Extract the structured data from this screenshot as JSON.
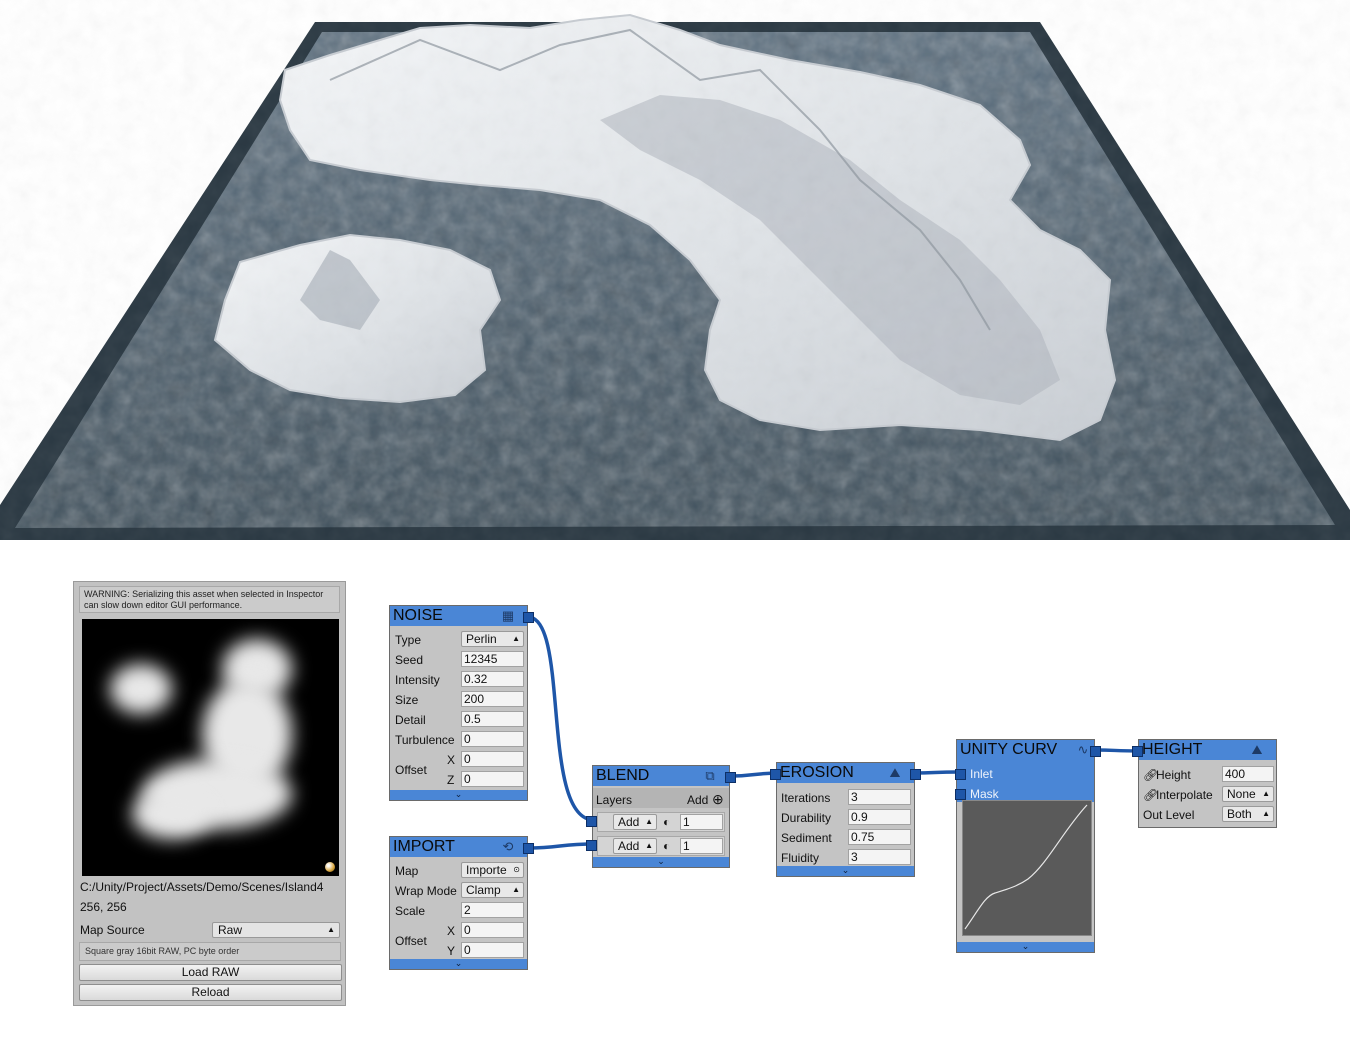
{
  "inspector": {
    "warning": "WARNING: Serializing this asset when selected in Inspector can slow down editor GUI performance.",
    "path": "C:/Unity/Project/Assets/Demo/Scenes/Island4",
    "size": "256, 256",
    "map_source_label": "Map Source",
    "map_source_value": "Raw",
    "hint": "Square gray 16bit RAW, PC byte order",
    "load_button": "Load RAW",
    "reload_button": "Reload"
  },
  "noise": {
    "title": "NOISE",
    "rows": [
      {
        "label": "Type",
        "value": "Perlin"
      },
      {
        "label": "Seed",
        "value": "12345"
      },
      {
        "label": "Intensity",
        "value": "0.32"
      },
      {
        "label": "Size",
        "value": "200"
      },
      {
        "label": "Detail",
        "value": "0.5"
      },
      {
        "label": "Turbulence",
        "value": "0"
      }
    ],
    "offset_label": "Offset",
    "x_label": "X",
    "x_value": "0",
    "z_label": "Z",
    "z_value": "0"
  },
  "import": {
    "title": "IMPORT",
    "map_label": "Map",
    "map_value": "Importe",
    "wrap_label": "Wrap Mode",
    "wrap_value": "Clamp",
    "scale_label": "Scale",
    "scale_value": "2",
    "offset_label": "Offset",
    "x_label": "X",
    "x_value": "0",
    "y_label": "Y",
    "y_value": "0"
  },
  "blend": {
    "title": "BLEND",
    "layers_label": "Layers",
    "add_label": "Add",
    "layers": [
      {
        "mode": "Add",
        "opacity": "1"
      },
      {
        "mode": "Add",
        "opacity": "1"
      }
    ]
  },
  "erosion": {
    "title": "EROSION",
    "rows": [
      {
        "label": "Iterations",
        "value": "3"
      },
      {
        "label": "Durability",
        "value": "0.9"
      },
      {
        "label": "Sediment",
        "value": "0.75"
      },
      {
        "label": "Fluidity",
        "value": "3"
      }
    ]
  },
  "curve": {
    "title": "UNITY CURV",
    "inlet_label": "Inlet",
    "mask_label": "Mask"
  },
  "height": {
    "title": "HEIGHT",
    "height_label": "Height",
    "height_value": "400",
    "interp_label": "Interpolate",
    "interp_value": "None",
    "out_label": "Out Level",
    "out_value": "Both"
  },
  "colors": {
    "node_header": "#4a86d6",
    "node_body": "#c4c4c4",
    "wire": "#1e56a8",
    "ocean": "#4f6270",
    "terrain_snow": "#e9ecef",
    "frame": "#2a3842"
  }
}
